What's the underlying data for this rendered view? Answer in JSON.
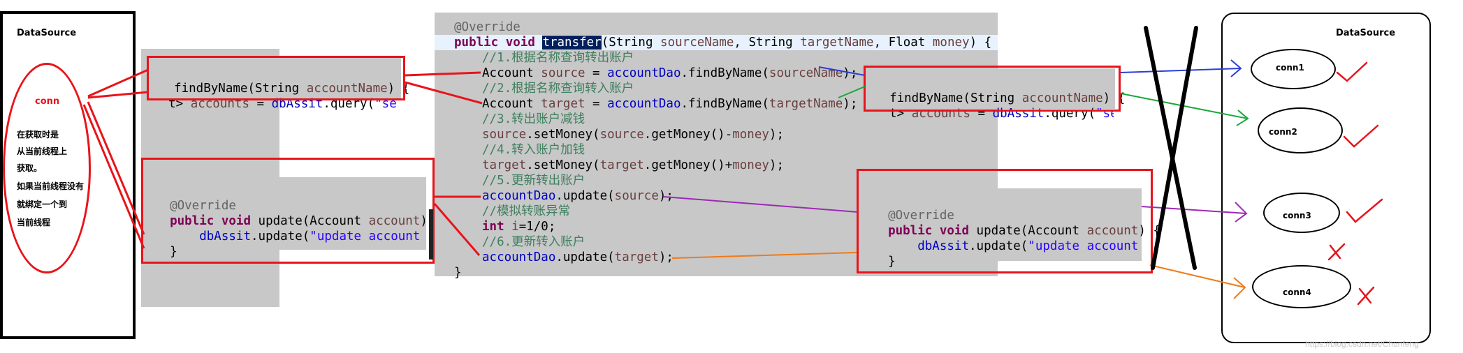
{
  "left_datasource": {
    "title": "DataSource",
    "conn_label": "conn",
    "note_lines": [
      "在获取时是",
      "从当前线程上",
      "获取。",
      "如果当前线程没有",
      "就绑定一个到",
      "当前线程"
    ]
  },
  "find_box_left": {
    "line1": {
      "p1": "findByName(",
      "p2": "String ",
      "p3": "accountName",
      "p4": ") {"
    },
    "line2": {
      "p1": "t> ",
      "p2": "accounts",
      "p3": " = ",
      "p4": "dbAssit",
      "p5": ".query(",
      "p6": "\"select"
    }
  },
  "update_box_left": {
    "line1": "@Override",
    "line2": {
      "p1": "public ",
      "p2": "void ",
      "p3": "update(Account ",
      "p4": "account",
      "p5": ") {"
    },
    "line3": {
      "p1": "    ",
      "p2": "dbAssit",
      "p3": ".update(",
      "p4": "\"update account set"
    },
    "line4": "}"
  },
  "transfer_code": {
    "l1": "@Override",
    "l2": {
      "p1": "public ",
      "p2": "void ",
      "p3": "transfer",
      "p4": "(String ",
      "p5": "sourceName",
      "p6": ", String ",
      "p7": "targetName",
      "p8": ", Float ",
      "p9": "money",
      "p10": ") {"
    },
    "l3": "//1.根据名称查询转出账户",
    "l4": {
      "p1": "Account ",
      "p2": "source",
      "p3": " = ",
      "p4": "accountDao",
      "p5": ".findByName(",
      "p6": "sourceName",
      "p7": ");"
    },
    "l5": "//2.根据名称查询转入账户",
    "l6": {
      "p1": "Account ",
      "p2": "target",
      "p3": " = ",
      "p4": "accountDao",
      "p5": ".findByName(",
      "p6": "targetName",
      "p7": ");"
    },
    "l7": "//3.转出账户减钱",
    "l8": {
      "p1": "source",
      "p2": ".setMoney(",
      "p3": "source",
      "p4": ".getMoney()-",
      "p5": "money",
      "p6": ");"
    },
    "l9": "//4.转入账户加钱",
    "l10": {
      "p1": "target",
      "p2": ".setMoney(",
      "p3": "target",
      "p4": ".getMoney()+",
      "p5": "money",
      "p6": ");"
    },
    "l11": "//5.更新转出账户",
    "l12": {
      "p1": "accountDao",
      "p2": ".update(",
      "p3": "source",
      "p4": ");"
    },
    "l13": "//模拟转账异常",
    "l14": {
      "p1": "int ",
      "p2": "i",
      "p3": "=1/0;"
    },
    "l15": "//6.更新转入账户",
    "l16": {
      "p1": "accountDao",
      "p2": ".update(",
      "p3": "target",
      "p4": ");"
    },
    "l17": "}"
  },
  "find_box_right": {
    "line1": {
      "p1": "findByName(",
      "p2": "String ",
      "p3": "accountName",
      "p4": ") {"
    },
    "line2": {
      "p1": "t> ",
      "p2": "accounts",
      "p3": " = ",
      "p4": "dbAssit",
      "p5": ".query(",
      "p6": "\"select"
    }
  },
  "update_box_right": {
    "line1": "@Override",
    "line2": {
      "p1": "public ",
      "p2": "void ",
      "p3": "update(Account ",
      "p4": "account",
      "p5": ") {"
    },
    "line3": {
      "p1": "    ",
      "p2": "dbAssit",
      "p3": ".update(",
      "p4": "\"update account set"
    },
    "line4": "}"
  },
  "right_datasource": {
    "title": "DataSource",
    "conns": [
      "conn1",
      "conn2",
      "conn3",
      "conn4"
    ]
  },
  "watermark": "https://blog.csdn.net/Chunfeng",
  "colors": {
    "red": "#e8141b",
    "blue": "#2b3fd6",
    "green": "#1aa83a",
    "purple": "#9b2ab4",
    "orange": "#f07a18",
    "code_bg": "#c8c8c8"
  }
}
